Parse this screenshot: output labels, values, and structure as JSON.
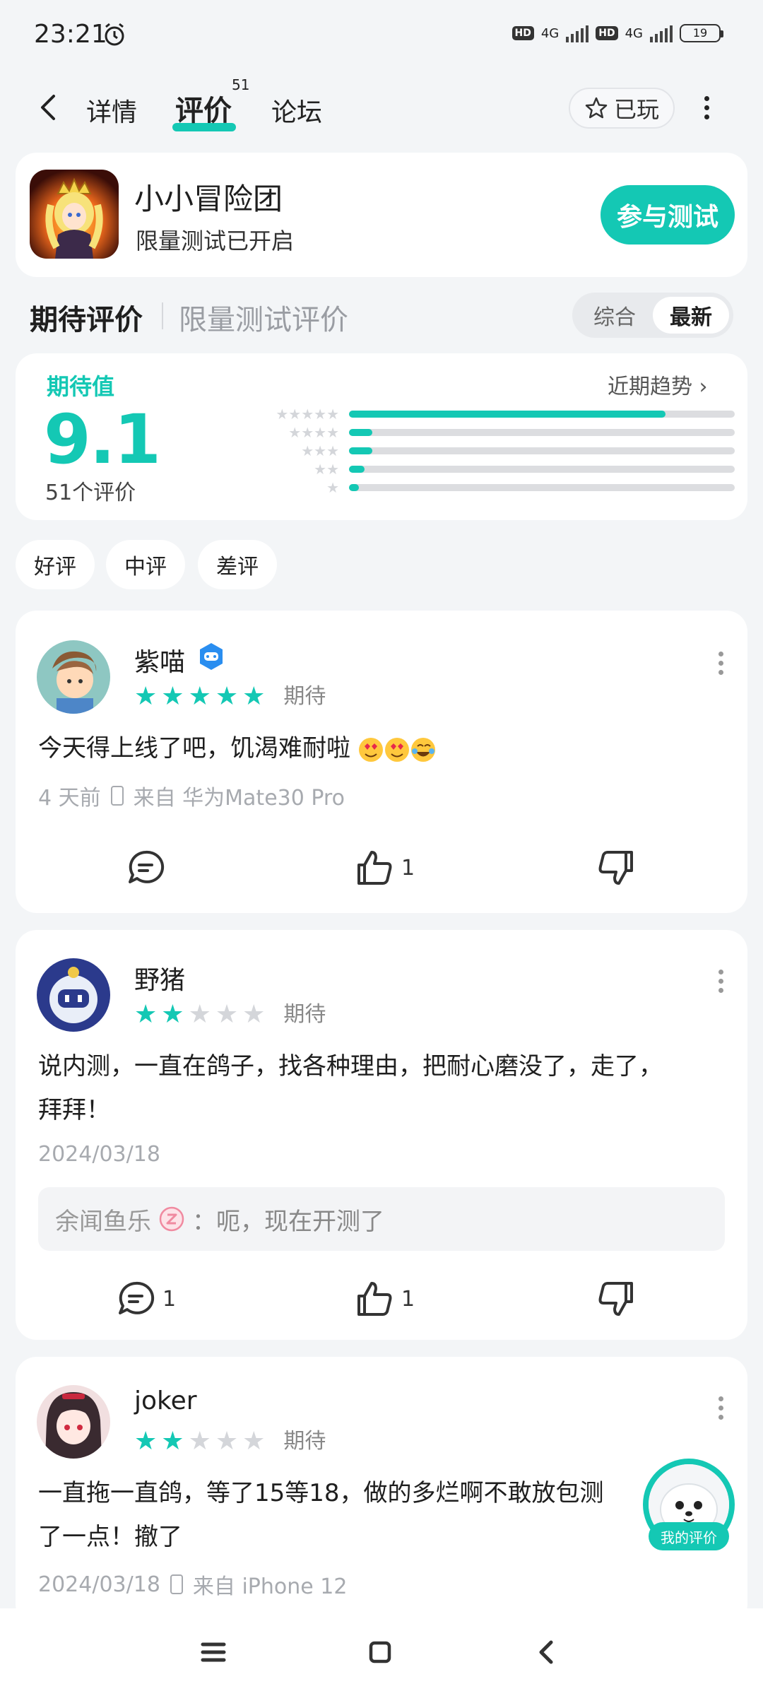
{
  "status_bar": {
    "time": "23:21",
    "network": "4G",
    "hd": "HD",
    "battery": "19"
  },
  "nav": {
    "tabs": [
      {
        "label": "详情"
      },
      {
        "label": "评价",
        "count": "51"
      },
      {
        "label": "论坛"
      }
    ],
    "played_label": "已玩"
  },
  "game": {
    "name": "小小冒险团",
    "subtitle": "限量测试已开启",
    "join_label": "参与测试"
  },
  "section": {
    "title": "期待评价",
    "alt_title": "限量测试评价",
    "sort_options": [
      "综合",
      "最新"
    ],
    "active_sort": "最新"
  },
  "rating": {
    "label": "期待值",
    "score": "9.1",
    "count_text": "51个评价",
    "trend_label": "近期趋势",
    "distribution": [
      {
        "stars": 5,
        "fraction": 0.82
      },
      {
        "stars": 4,
        "fraction": 0.06
      },
      {
        "stars": 3,
        "fraction": 0.06
      },
      {
        "stars": 2,
        "fraction": 0.04
      },
      {
        "stars": 1,
        "fraction": 0.02
      }
    ]
  },
  "filters": [
    "好评",
    "中评",
    "差评"
  ],
  "reviews": [
    {
      "user": "紫喵",
      "stars": 5,
      "tag": "期待",
      "content": "今天得上线了吧，饥渴难耐啦",
      "time": "4 天前",
      "device": "来自 华为Mate30 Pro",
      "likes": "1"
    },
    {
      "user": "野猪",
      "stars": 2,
      "tag": "期待",
      "content_line1": "说内测，一直在鸽子，找各种理由，把耐心磨没了，走了，",
      "content_line2": "拜拜！",
      "time": "2024/03/18",
      "reply_user": "余闻鱼乐",
      "reply_text": "：呃，现在开测了",
      "comments": "1",
      "likes": "1"
    },
    {
      "user": "joker",
      "stars": 2,
      "tag": "期待",
      "content_line1": "一直拖一直鸽，等了15等18，做的多烂啊不敢放包测",
      "content_line2": "了一点！撤了",
      "time": "2024/03/18",
      "device": "来自 iPhone 12"
    }
  ],
  "my_review_label": "我的评价",
  "colors": {
    "accent": "#14c8b4",
    "background": "#f3f5f7"
  }
}
